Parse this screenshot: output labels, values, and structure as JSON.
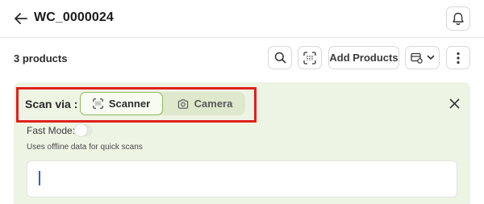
{
  "header": {
    "title": "WC_0000024",
    "back_icon": "arrow-left-icon",
    "bell_icon": "bell-icon"
  },
  "toolbar": {
    "count_label": "3 products",
    "search_icon": "search-icon",
    "scan_icon": "barcode-scan-icon",
    "add_label": "Add Products",
    "filter_icon": "filter-icon",
    "more_icon": "more-vertical-icon"
  },
  "scan_panel": {
    "scan_via_label": "Scan via :",
    "scanner_label": "Scanner",
    "camera_label": "Camera",
    "selected": "Scanner",
    "fast_mode_label": "Fast Mode:",
    "fast_mode_on": false,
    "helper_text": "Uses offline data for quick scans",
    "input_value": ""
  },
  "colors": {
    "panel_bg": "#eef4e4",
    "accent_green": "#8fb560",
    "highlight_red": "#e0201b",
    "caret_blue": "#2b5fd9"
  }
}
